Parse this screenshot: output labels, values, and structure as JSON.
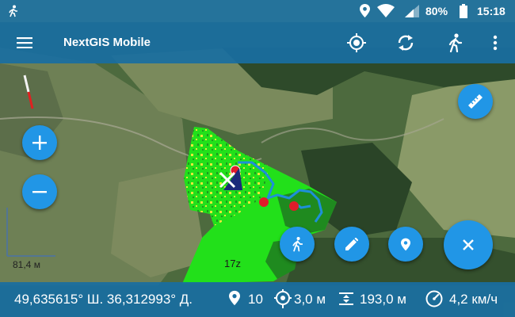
{
  "status_bar": {
    "battery_percent": "80%",
    "time": "15:18",
    "icons": [
      "walk-icon",
      "location-pin-icon",
      "wifi-icon",
      "signal-icon",
      "battery-icon"
    ]
  },
  "toolbar": {
    "title": "NextGIS Mobile",
    "icons": [
      "menu-icon",
      "gps-target-icon",
      "sync-icon",
      "walk-icon",
      "more-vert-icon"
    ]
  },
  "map": {
    "scale_label": "81,4 м",
    "feature_label": "17z"
  },
  "fabs": {
    "zoom_in": "plus-icon",
    "zoom_out": "minus-icon",
    "ruler": "ruler-icon",
    "track": "walk-icon",
    "edit": "pencil-icon",
    "add_point": "location-pin-icon",
    "close": "close-icon"
  },
  "bottom_bar": {
    "coordinates": "49,635615° Ш. 36,312993° Д.",
    "satellites": "10",
    "accuracy": "3,0 м",
    "altitude": "193,0 м",
    "speed": "4,2 км/ч"
  },
  "colors": {
    "primary": "#2196e6",
    "toolbar": "#196ea0",
    "zone_bright": "#22e01a",
    "zone_yellow": "#e8e83a",
    "zone_dark": "#1f8a1f",
    "marker": "#e01c2a",
    "track": "#1e90d8"
  }
}
